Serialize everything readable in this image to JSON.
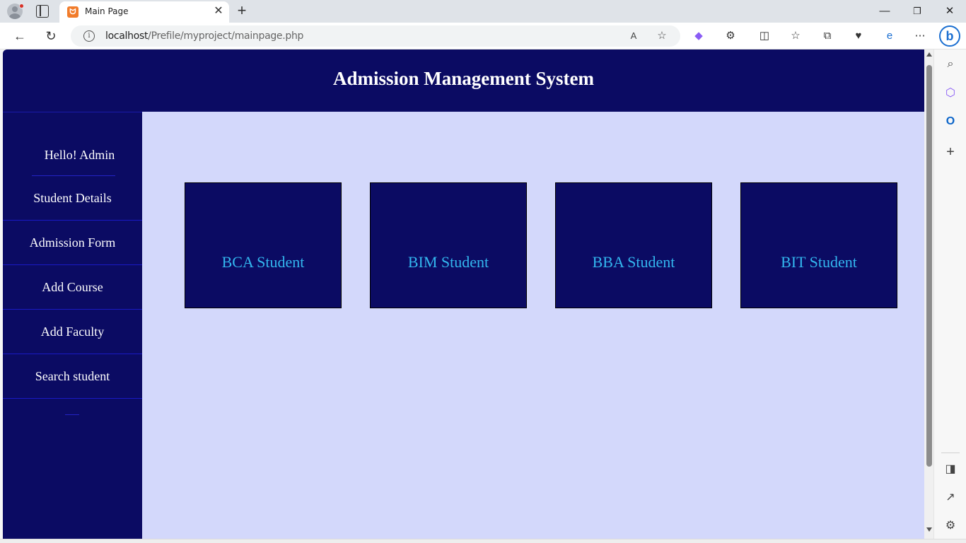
{
  "browser": {
    "tab_title": "Main Page",
    "tab_favicon": "xampp-icon",
    "url_host": "localhost",
    "url_path": "/Prefile/myproject/mainpage.php"
  },
  "page": {
    "title": "Admission Management System",
    "greeting": "Hello! Admin",
    "menu": [
      {
        "label": "Student Details"
      },
      {
        "label": "Admission Form"
      },
      {
        "label": "Add Course"
      },
      {
        "label": "Add Faculty"
      },
      {
        "label": "Search student"
      }
    ],
    "cards": [
      {
        "label": "BCA Student"
      },
      {
        "label": "BIM Student"
      },
      {
        "label": "BBA Student"
      },
      {
        "label": "BIT Student"
      }
    ]
  },
  "colors": {
    "header_bg": "#0b0b63",
    "content_bg": "#d3d8fb",
    "card_text": "#33b7ef",
    "menu_divider": "#1a1ac4"
  }
}
